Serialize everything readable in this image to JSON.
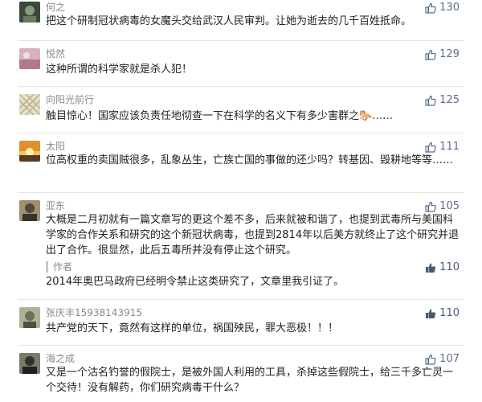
{
  "comments": [
    {
      "user": "何之",
      "likes": "130",
      "text": "把这个研制冠状病毒的女魔头交给武汉人民审判。让她为逝去的几千百姓抵命。",
      "avatar_colors": [
        "#3a4a3a",
        "#8a9a7a"
      ]
    },
    {
      "user": "悦然",
      "likes": "129",
      "text": "这种所谓的科学家就是杀人犯！",
      "avatar_colors": [
        "#b07a8a",
        "#d8b0c0"
      ]
    },
    {
      "user": "向阳光前行",
      "likes": "125",
      "text": "触目惊心！国家应该负责任地彻查一下在科学的名义下有多少害群之🐎……",
      "avatar_colors": [
        "#c8c0a0",
        "#e8e0c8"
      ]
    },
    {
      "user": "太阳",
      "likes": "111",
      "text": "位高权重的卖国贼很多，乱象丛生，亡族亡国的事做的还少吗？转基因、毁耕地等等……",
      "avatar_colors": [
        "#e0902a",
        "#f8d070"
      ]
    },
    {
      "user": "亚东",
      "likes": "105",
      "text": "大概是二月初就有一篇文章写的更这个差不多，后来就被和谐了，也提到武毒所与美国科学家的合作关系和研究的这个新冠状病毒，也提到2814年以后美方就终止了这个研究并退出了合作。很显然，此后五毒所并没有停止这个研究。",
      "avatar_colors": [
        "#50483a",
        "#a09070"
      ]
    },
    {
      "user": "张庆丰15938143915",
      "likes": "110",
      "text": "共产党的天下，竟然有这样的单位，祸国殃民，罪大恶极！！！",
      "avatar_colors": [
        "#6a7060",
        "#b0b098"
      ]
    },
    {
      "user": "海之成",
      "likes": "107",
      "text": "又是一个沽名钓誉的假院士，是被外国人利用的工具，杀掉这些假院士，给三千多亡灵一个交待！没有解药，你们研究病毒干什么？",
      "avatar_colors": [
        "#303030",
        "#7a7a6a"
      ]
    }
  ],
  "reply": {
    "label": "作者",
    "likes": "110",
    "text": "2014年奥巴马政府已经明令禁止这类研究了，文章里我引证了。"
  }
}
